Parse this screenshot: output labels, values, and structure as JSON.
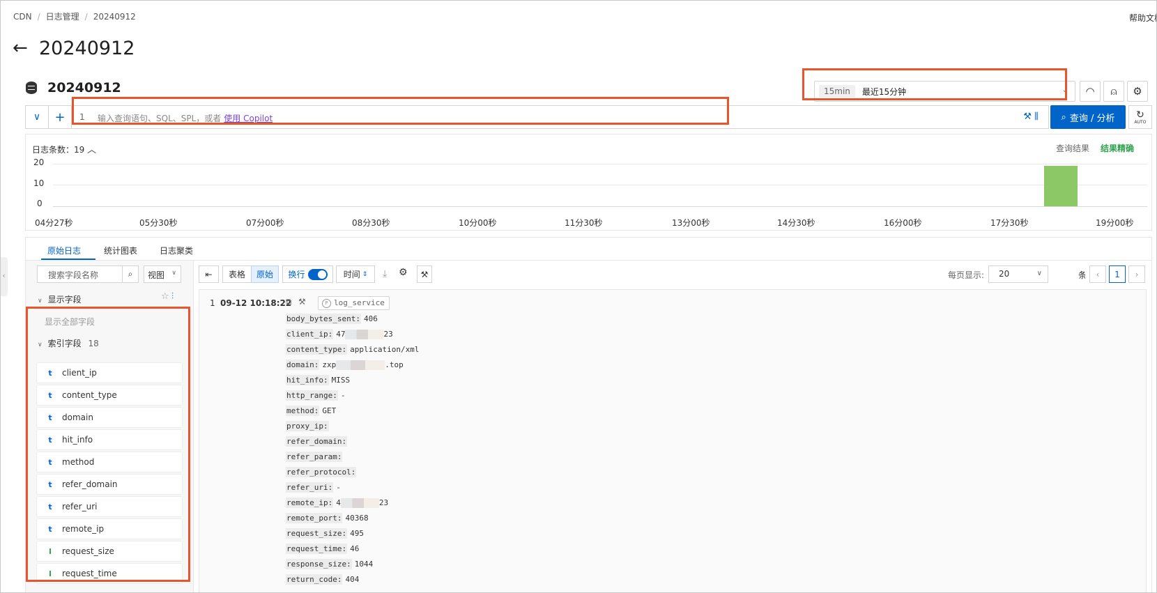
{
  "breadcrumb": [
    "CDN",
    "日志管理",
    "20240912"
  ],
  "help_link": "帮助文档",
  "page_title": "20240912",
  "logstore_title": "20240912",
  "time_range": {
    "chip": "15min",
    "label": "最近15分钟"
  },
  "query": {
    "line_number": "1",
    "placeholder": "输入查询语句、SQL、SPL，或者",
    "copilot_link": "使用 Copilot",
    "submit_label": "查询 / 分析",
    "auto_label": "AUTO"
  },
  "histogram": {
    "count_label": "日志条数：",
    "count_value": "19",
    "result_label": "查询结果",
    "result_status": "结果精确",
    "status_color": "#2fa24f",
    "y_ticks": [
      "20",
      "10",
      "0"
    ],
    "x_ticks": [
      "04分27秒",
      "05分30秒",
      "07分00秒",
      "08分30秒",
      "10分00秒",
      "11分30秒",
      "13分00秒",
      "14分30秒",
      "16分00秒",
      "17分30秒",
      "19分00秒"
    ],
    "bar_value": 19,
    "bar_color": "#8cc866"
  },
  "tabs": [
    "原始日志",
    "统计图表",
    "日志聚类"
  ],
  "field_panel": {
    "search_placeholder": "搜索字段名称",
    "view_label": "视图",
    "display_section": "显示字段",
    "show_all": "显示全部字段",
    "index_section": "索引字段",
    "index_count": "18",
    "fields": [
      {
        "type": "t",
        "name": "client_ip"
      },
      {
        "type": "t",
        "name": "content_type"
      },
      {
        "type": "t",
        "name": "domain"
      },
      {
        "type": "t",
        "name": "hit_info"
      },
      {
        "type": "t",
        "name": "method"
      },
      {
        "type": "t",
        "name": "refer_domain"
      },
      {
        "type": "t",
        "name": "refer_uri"
      },
      {
        "type": "t",
        "name": "remote_ip"
      },
      {
        "type": "l",
        "name": "request_size"
      },
      {
        "type": "l",
        "name": "request_time"
      }
    ]
  },
  "toolbar": {
    "table_label": "表格",
    "raw_label": "原始",
    "wrap_label": "换行",
    "time_label": "时间",
    "per_page_label": "每页显示:",
    "page_size": "20",
    "page_suffix": "条",
    "current_page": "1"
  },
  "log": {
    "index": "1",
    "time": "09-12 10:18:22",
    "source": "log_service",
    "fields": [
      {
        "key": "body_bytes_sent:",
        "value": "406"
      },
      {
        "key": "client_ip:",
        "value": "47",
        "suffix": "23",
        "masked": true
      },
      {
        "key": "content_type:",
        "value": "application/xml"
      },
      {
        "key": "domain:",
        "value": "zxp",
        "suffix": ".top",
        "masked": true
      },
      {
        "key": "hit_info:",
        "value": "MISS"
      },
      {
        "key": "http_range:",
        "value": "-"
      },
      {
        "key": "method:",
        "value": "GET"
      },
      {
        "key": "proxy_ip:",
        "value": ""
      },
      {
        "key": "refer_domain:",
        "value": ""
      },
      {
        "key": "refer_param:",
        "value": ""
      },
      {
        "key": "refer_protocol:",
        "value": ""
      },
      {
        "key": "refer_uri:",
        "value": "-"
      },
      {
        "key": "remote_ip:",
        "value": "4",
        "suffix": "23",
        "masked": true
      },
      {
        "key": "remote_port:",
        "value": "40368"
      },
      {
        "key": "request_size:",
        "value": "495"
      },
      {
        "key": "request_time:",
        "value": "46"
      },
      {
        "key": "response_size:",
        "value": "1044"
      },
      {
        "key": "return_code:",
        "value": "404"
      }
    ]
  },
  "colors": {
    "accent": "#0064c8",
    "highlight_box": "#e8552d"
  }
}
